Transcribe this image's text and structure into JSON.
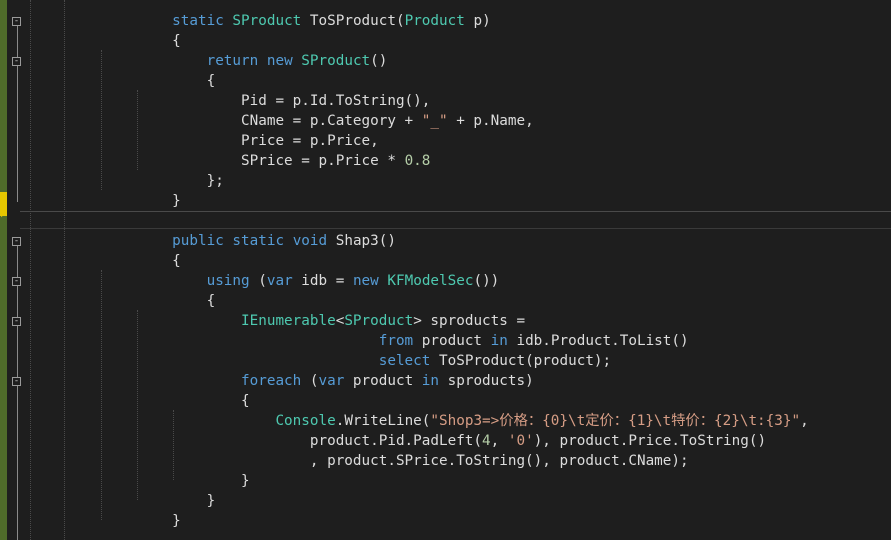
{
  "editor": {
    "language": "C#",
    "theme_colors": {
      "background": "#1e1e1e",
      "keyword": "#569cd6",
      "type": "#4ec9b0",
      "string": "#d69d85",
      "number": "#b5cea8",
      "plain": "#dcdcdc",
      "change_saved": "#4f6b2a",
      "change_unsaved": "#e5c700"
    },
    "lines": [
      {
        "indent": "        ",
        "tokens": [
          {
            "t": "static",
            "k": "kw"
          },
          {
            "t": " "
          },
          {
            "t": "SProduct",
            "k": "ty"
          },
          {
            "t": " ToSProduct("
          },
          {
            "t": "Product",
            "k": "ty"
          },
          {
            "t": " p)"
          }
        ]
      },
      {
        "indent": "        ",
        "tokens": [
          {
            "t": "{"
          }
        ]
      },
      {
        "indent": "            ",
        "tokens": [
          {
            "t": "return",
            "k": "kw"
          },
          {
            "t": " "
          },
          {
            "t": "new",
            "k": "kw"
          },
          {
            "t": " "
          },
          {
            "t": "SProduct",
            "k": "ty"
          },
          {
            "t": "()"
          }
        ]
      },
      {
        "indent": "            ",
        "tokens": [
          {
            "t": "{"
          }
        ]
      },
      {
        "indent": "                ",
        "tokens": [
          {
            "t": "Pid = p.Id.ToString(),"
          }
        ]
      },
      {
        "indent": "                ",
        "tokens": [
          {
            "t": "CName = p.Category + "
          },
          {
            "t": "\"_\"",
            "k": "str"
          },
          {
            "t": " + p.Name,"
          }
        ]
      },
      {
        "indent": "                ",
        "tokens": [
          {
            "t": "Price = p.Price,"
          }
        ]
      },
      {
        "indent": "                ",
        "tokens": [
          {
            "t": "SPrice = p.Price * "
          },
          {
            "t": "0.8",
            "k": "num"
          }
        ]
      },
      {
        "indent": "            ",
        "tokens": [
          {
            "t": "};"
          }
        ]
      },
      {
        "indent": "        ",
        "tokens": [
          {
            "t": "}"
          }
        ]
      },
      {
        "indent": "",
        "tokens": []
      },
      {
        "indent": "        ",
        "tokens": [
          {
            "t": "public",
            "k": "kw"
          },
          {
            "t": " "
          },
          {
            "t": "static",
            "k": "kw"
          },
          {
            "t": " "
          },
          {
            "t": "void",
            "k": "kw"
          },
          {
            "t": " Shap3()"
          }
        ]
      },
      {
        "indent": "        ",
        "tokens": [
          {
            "t": "{"
          }
        ]
      },
      {
        "indent": "            ",
        "tokens": [
          {
            "t": "using",
            "k": "kw"
          },
          {
            "t": " ("
          },
          {
            "t": "var",
            "k": "kw"
          },
          {
            "t": " idb = "
          },
          {
            "t": "new",
            "k": "kw"
          },
          {
            "t": " "
          },
          {
            "t": "KFModelSec",
            "k": "ty"
          },
          {
            "t": "())"
          }
        ]
      },
      {
        "indent": "            ",
        "tokens": [
          {
            "t": "{"
          }
        ]
      },
      {
        "indent": "                ",
        "tokens": [
          {
            "t": "IEnumerable",
            "k": "ty"
          },
          {
            "t": "<"
          },
          {
            "t": "SProduct",
            "k": "ty"
          },
          {
            "t": "> sproducts ="
          }
        ]
      },
      {
        "indent": "                                ",
        "tokens": [
          {
            "t": "from",
            "k": "kw"
          },
          {
            "t": " product "
          },
          {
            "t": "in",
            "k": "kw"
          },
          {
            "t": " idb.Product.ToList()"
          }
        ]
      },
      {
        "indent": "                                ",
        "tokens": [
          {
            "t": "select",
            "k": "kw"
          },
          {
            "t": " ToSProduct(product);"
          }
        ]
      },
      {
        "indent": "                ",
        "tokens": [
          {
            "t": "foreach",
            "k": "kw"
          },
          {
            "t": " ("
          },
          {
            "t": "var",
            "k": "kw"
          },
          {
            "t": " product "
          },
          {
            "t": "in",
            "k": "kw"
          },
          {
            "t": " sproducts)"
          }
        ]
      },
      {
        "indent": "                ",
        "tokens": [
          {
            "t": "{"
          }
        ]
      },
      {
        "indent": "                    ",
        "tokens": [
          {
            "t": "Console",
            "k": "ty"
          },
          {
            "t": ".WriteLine("
          },
          {
            "t": "\"Shop3=>价格：{0}\\t定价：{1}\\t特价：{2}\\t:{3}\"",
            "k": "str"
          },
          {
            "t": ","
          }
        ]
      },
      {
        "indent": "                        ",
        "tokens": [
          {
            "t": "product.Pid.PadLeft("
          },
          {
            "t": "4",
            "k": "num"
          },
          {
            "t": ", "
          },
          {
            "t": "'0'",
            "k": "str"
          },
          {
            "t": "), product.Price.ToString()"
          }
        ]
      },
      {
        "indent": "                        ",
        "tokens": [
          {
            "t": ", product.SPrice.ToString(), product.CName);"
          }
        ]
      },
      {
        "indent": "                ",
        "tokens": [
          {
            "t": "}"
          }
        ]
      },
      {
        "indent": "            ",
        "tokens": [
          {
            "t": "}"
          }
        ]
      },
      {
        "indent": "        ",
        "tokens": [
          {
            "t": "}"
          }
        ]
      }
    ],
    "fold_glyph": "-",
    "cursor_glyph": "›"
  }
}
